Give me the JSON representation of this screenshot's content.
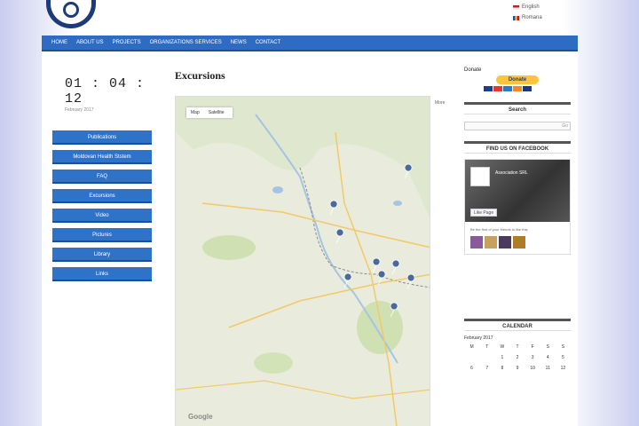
{
  "header": {
    "site_title": "",
    "languages": [
      {
        "label": "English",
        "flag": "en"
      },
      {
        "label": "Romana",
        "flag": "ro"
      }
    ]
  },
  "nav": {
    "items": [
      "HOME",
      "ABOUT US",
      "PROJECTS",
      "ORGANIZATIONS SERVICES",
      "NEWS",
      "CONTACT"
    ]
  },
  "clock": {
    "time": "01 : 04 : 12",
    "date": "February 2017"
  },
  "side_menu": {
    "items": [
      "Publications",
      "Moldovan Health Ststem",
      "FAQ",
      "Excursions",
      "Video",
      "Pictures",
      "Library",
      "Links"
    ]
  },
  "main": {
    "title": "Excursions",
    "map": {
      "type_map": "Map",
      "type_satellite": "Satellite",
      "google_label": "Google",
      "more_label": "More"
    }
  },
  "sidebar": {
    "donate_label": "Donate",
    "donate_button": "Donate",
    "search_title": "Search",
    "search_button": "Go",
    "facebook_title": "FIND US ON FACEBOOK",
    "fb_page_name": "Association SRL",
    "fb_like": "Like Page",
    "fb_friends": "Be the first of your friends to like this",
    "calendar_title": "CALENDAR",
    "calendar_month": "February 2017",
    "calendar_days": [
      "M",
      "T",
      "W",
      "T",
      "F",
      "S",
      "S"
    ],
    "calendar_rows": [
      [
        "",
        "",
        "1",
        "2",
        "3",
        "4",
        "5"
      ],
      [
        "6",
        "7",
        "8",
        "9",
        "10",
        "11",
        "12"
      ]
    ]
  },
  "colors": {
    "nav": "#2e6bc2",
    "menu_button": "#2f73c8",
    "donate": "#ffc439",
    "map_land": "#e9ecdd",
    "map_forest": "#c8dfa8",
    "map_road": "#f3c868"
  }
}
